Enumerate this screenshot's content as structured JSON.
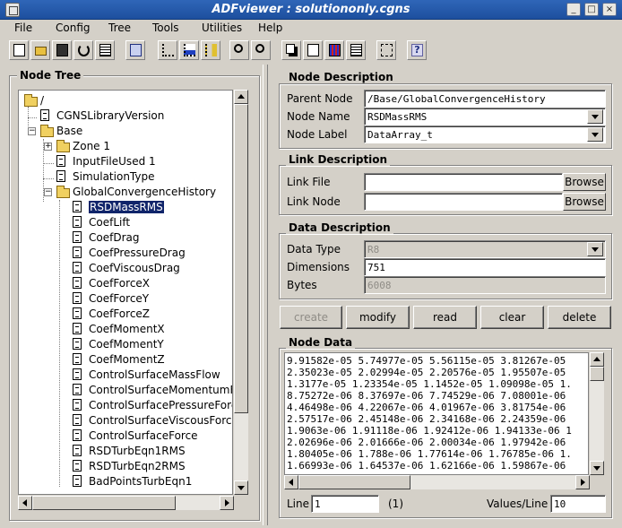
{
  "window": {
    "title": "ADFviewer : solutiononly.cgns",
    "minimize": "_",
    "maximize": "□",
    "close": "×"
  },
  "menu": {
    "items": [
      "File",
      "Config",
      "Tree",
      "Tools",
      "Utilities",
      "Help"
    ]
  },
  "toolbar": {
    "icons": [
      "new-icon",
      "open-icon",
      "save-icon",
      "refresh-icon",
      "properties-icon",
      "view-icon",
      "tree-sort-icon",
      "tree-down-icon",
      "tree-num-icon",
      "search-icon",
      "search-next-icon",
      "copy-icon",
      "check-icon",
      "grid-icon",
      "calculator-icon",
      "links-icon",
      "help-icon"
    ],
    "help_label": "?"
  },
  "tree": {
    "title": "Node Tree",
    "rows": [
      {
        "label": "/"
      },
      {
        "label": "CGNSLibraryVersion"
      },
      {
        "label": "Base"
      },
      {
        "label": "Zone   1"
      },
      {
        "label": "InputFileUsed 1"
      },
      {
        "label": "SimulationType"
      },
      {
        "label": "GlobalConvergenceHistory"
      },
      {
        "label": "RSDMassRMS"
      },
      {
        "label": "CoefLift"
      },
      {
        "label": "CoefDrag"
      },
      {
        "label": "CoefPressureDrag"
      },
      {
        "label": "CoefViscousDrag"
      },
      {
        "label": "CoefForceX"
      },
      {
        "label": "CoefForceY"
      },
      {
        "label": "CoefForceZ"
      },
      {
        "label": "CoefMomentX"
      },
      {
        "label": "CoefMomentY"
      },
      {
        "label": "CoefMomentZ"
      },
      {
        "label": "ControlSurfaceMassFlow"
      },
      {
        "label": "ControlSurfaceMomentumFo"
      },
      {
        "label": "ControlSurfacePressureForc"
      },
      {
        "label": "ControlSurfaceViscousForce"
      },
      {
        "label": "ControlSurfaceForce"
      },
      {
        "label": "RSDTurbEqn1RMS"
      },
      {
        "label": "RSDTurbEqn2RMS"
      },
      {
        "label": "BadPointsTurbEqn1"
      }
    ],
    "expand_plus": "+",
    "expand_minus": "−"
  },
  "node_description": {
    "title": "Node Description",
    "parent_label": "Parent Node",
    "parent_value": "/Base/GlobalConvergenceHistory",
    "name_label": "Node Name",
    "name_value": "RSDMassRMS",
    "nodelabel_label": "Node Label",
    "nodelabel_value": "DataArray_t"
  },
  "link_description": {
    "title": "Link Description",
    "file_label": "Link File",
    "file_value": "",
    "browse": "Browse",
    "node_label": "Link Node",
    "node_value": ""
  },
  "data_description": {
    "title": "Data Description",
    "type_label": "Data Type",
    "type_value": "R8",
    "dims_label": "Dimensions",
    "dims_value": "751",
    "bytes_label": "Bytes",
    "bytes_value": "6008"
  },
  "actions": {
    "create": "create",
    "modify": "modify",
    "read": "read",
    "clear": "clear",
    "delete": "delete"
  },
  "node_data": {
    "title": "Node Data",
    "lines": [
      "9.91582e-05 5.74977e-05 5.56115e-05 3.81267e-05",
      "2.35023e-05 2.02994e-05 2.20576e-05 1.95507e-05",
      "1.3177e-05 1.23354e-05 1.1452e-05 1.09098e-05 1.",
      "8.75272e-06 8.37697e-06 7.74529e-06 7.08001e-06",
      "4.46498e-06 4.22067e-06 4.01967e-06 3.81754e-06",
      "2.57517e-06 2.45148e-06 2.34168e-06 2.24359e-06",
      "1.9063e-06 1.91118e-06 1.92412e-06 1.94133e-06 1",
      "2.02696e-06 2.01666e-06 2.00034e-06 1.97942e-06",
      "1.80405e-06 1.788e-06 1.77614e-06 1.76785e-06 1.",
      "1.66993e-06 1.64537e-06 1.62166e-06 1.59867e-06"
    ],
    "line_label": "Line",
    "line_value": "1",
    "line_count": "(1)",
    "values_label": "Values/Line",
    "values_value": "10"
  }
}
